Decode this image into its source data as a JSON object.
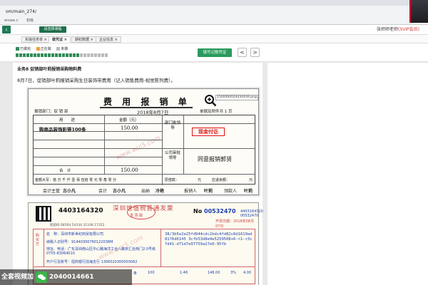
{
  "browser": {
    "url": "om/main_274/",
    "bookmarks": [
      "ensee.c",
      "初级"
    ]
  },
  "header": {
    "course_select": "请选择课程",
    "user": "张师师老师",
    "vip": "(SVIP会员)"
  },
  "course_tabs": [
    {
      "label": "实操任务单",
      "active": false
    },
    {
      "label": "做凭证",
      "active": true
    },
    {
      "label": "期初数据",
      "active": false
    },
    {
      "label": "企业信息",
      "active": false
    }
  ],
  "status": {
    "done": "已做完",
    "doing": "正在做",
    "undone": "未做",
    "done_color": "#2e8b57",
    "doing_color": "#f0a030",
    "undone_color": "#bbbbbb"
  },
  "toolbar": {
    "fill_voucher": "填写记账凭证",
    "prev": "<",
    "next": ">"
  },
  "question": {
    "title": "业务8 促销部叶莉报销采购物料费",
    "desc": "8月7日，促销部叶莉报销采购生日装饰带费用（记入销售费用-视觉陈列费）。"
  },
  "expense_form": {
    "title": "费 用 报 销 单",
    "dept": "报销部门：促 销 部",
    "date": "2018年8月7日",
    "attachments": "单据及附件共 1 页",
    "col_use": "用　　途",
    "col_amount": "金额（元）",
    "item1": "购商品装饰彩带100条",
    "item1_amount": "150.00",
    "dept_approver": "部门批领导",
    "company_approver": "公司审批领导",
    "cash_stamp": "现金付讫",
    "approval": "同意报销郭贤",
    "total_label": "合　计",
    "total": "150.00",
    "amount_words": "金额大写：拾 万 千 仟 壹 佰 伍拾 零 元 零 角 零 分",
    "original_borrow": "原借款：",
    "yuan": "元",
    "due": "应退余额：",
    "sign_accounting_supervisor": "会计主管",
    "name_1": "古小凡",
    "sign_accounting": "会计",
    "name_2": "古小凡",
    "sign_cashier": "出纳",
    "name_3": "冷艳",
    "sign_reporter": "报销人",
    "name_4": "叶莉",
    "sign_receiver": "领款人",
    "name_5": "叶莉",
    "filename": "1500092024434439.png"
  },
  "invoice": {
    "code": "4403164320",
    "title": "深圳增值税普通发票",
    "sub": "发 票 联",
    "no_label": "No",
    "no": "00532470",
    "no2": "4403164320\n00532470",
    "date": "开票日期：2018年08月07日",
    "check_code": "校验码 68564 54334 31108 17352",
    "buyer_name": "名　称：深圳市新世纪商贸有限公司",
    "buyer_tax": "纳税人识别号：91440300760122038M",
    "buyer_addr": "地址、电话：广东深圳南山区中心路海洋工业八路京汇处南门2.0号栋 0755-83064010",
    "buyer_bank": "开户行及账号：招商银行前海支行 1306020300003062",
    "cipher": "38/3b5e2e25fd944cdc2bdc4fd82c8d1619ad8176d6145 3cfb53d8e4e5259508+6-<1-<3c7d41-d71d7e97759a27e0-95fb",
    "row_unit": "条",
    "row_qty": "100",
    "row_price": "1.46",
    "row_amount": "146.00",
    "row_rate": "3%",
    "row_tax": "4.00"
  },
  "watermark": {
    "text": "全套视频加",
    "wechat": "2040014661",
    "site": "www.acc5.com"
  }
}
